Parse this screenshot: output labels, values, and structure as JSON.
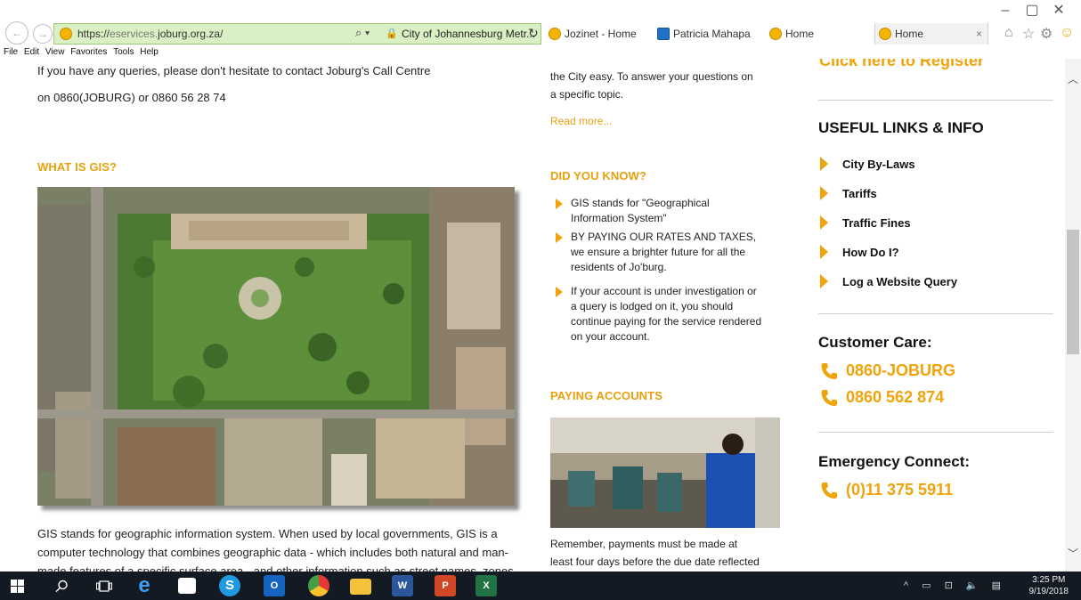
{
  "browser": {
    "url_prefix": "https://",
    "url_dim": "eservices.",
    "url_main": "joburg.org.za/",
    "search_glyph": "⌕ ▾",
    "lock_glyph": "🔒",
    "site_identity": "City of Johannesburg Metr...",
    "refresh_glyph": "↻",
    "tabs": [
      {
        "label": "Jozinet - Home",
        "icon": "joburg-favicon"
      },
      {
        "label": "Patricia Mahapa",
        "icon": "outlook-favicon"
      },
      {
        "label": "Home",
        "icon": "joburg-favicon"
      },
      {
        "label": "Home",
        "icon": "joburg-favicon",
        "active": true
      }
    ],
    "tab_close": "×",
    "window_controls": [
      "–",
      "▢",
      "✕"
    ],
    "toolbar_icons": [
      "⌂",
      "☆",
      "⚙",
      "☺"
    ],
    "menu": [
      "File",
      "Edit",
      "View",
      "Favorites",
      "Tools",
      "Help"
    ]
  },
  "left": {
    "queries_line1": "If you have any queries, please don't hesitate to contact Joburg's Call Centre",
    "queries_line2": "on 0860(JOBURG) or 0860 56 28 74",
    "gis_heading": "WHAT IS GIS?",
    "gis_body_1": "GIS stands for geographic information system. When used by local governments, GIS is a",
    "gis_body_2": "computer technology that combines geographic data - which includes both natural and man-",
    "gis_body_3": "made features of a specific surface area - and other information such as street names, zones"
  },
  "middle": {
    "intro_1": "the City easy. To answer your questions on",
    "intro_2": "a specific topic.",
    "read_more": "Read more...",
    "did_you_know_heading": "DID YOU KNOW?",
    "facts": [
      {
        "l1": "GIS stands for \"Geographical",
        "l2": "Information System\""
      },
      {
        "l1": "BY PAYING OUR RATES AND TAXES,",
        "l2": "we ensure a brighter future for all the",
        "l3": "residents of Jo'burg."
      },
      {
        "l1": "If your account is under investigation or",
        "l2": "a query is lodged on it, you should",
        "l3": "continue paying for the service rendered",
        "l4": "on your account."
      }
    ],
    "paying_heading": "PAYING ACCOUNTS",
    "payment_1": "Remember, payments must be made at",
    "payment_2": "least four days before the due date reflected"
  },
  "right": {
    "register": "Click here to Register",
    "useful_heading": "USEFUL LINKS & INFO",
    "links": [
      "City By-Laws",
      "Tariffs",
      "Traffic Fines",
      "How Do I?",
      "Log a Website Query"
    ],
    "customer_care_heading": "Customer Care:",
    "phones": [
      "0860-JOBURG",
      "0860 562 874"
    ],
    "emergency_heading": "Emergency Connect:",
    "emergency_phone": "(0)11 375 5911"
  },
  "taskbar": {
    "time": "3:25 PM",
    "date": "9/19/2018",
    "tray": "^ ▭ ⊡ 🔈 ▤"
  },
  "colors": {
    "accent": "#f0a30a",
    "heading_orange": "#e8a10c",
    "address_bar": "#d9f0c4",
    "taskbar": "#141a24"
  }
}
